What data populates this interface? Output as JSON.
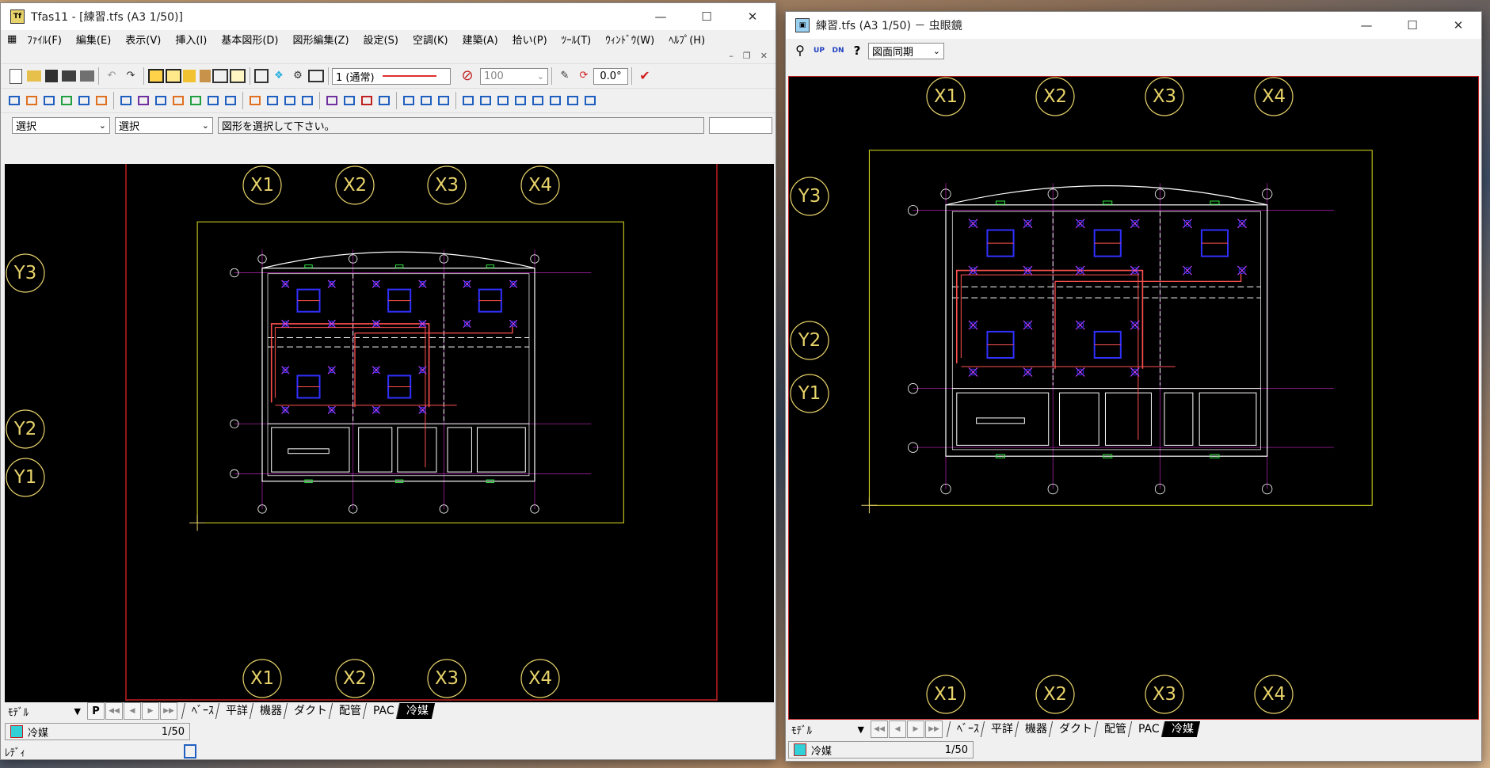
{
  "main": {
    "title": "Tfas11 - [練習.tfs (A3 1/50)]",
    "menu": [
      "ﾌｧｲﾙ(F)",
      "編集(E)",
      "表示(V)",
      "挿入(I)",
      "基本図形(D)",
      "図形編集(Z)",
      "設定(S)",
      "空調(K)",
      "建築(A)",
      "拾い(P)",
      "ﾂｰﾙ(T)",
      "ｳｨﾝﾄﾞｳ(W)",
      "ﾍﾙﾌﾟ(H)"
    ],
    "line_type": "1 (通常)",
    "scale_value": "100",
    "angle": "0.0°",
    "mode_select_1": "選択",
    "mode_select_2": "選択",
    "message": "図形を選択して下さい。",
    "layer_mode": "ﾓﾃﾞﾙ",
    "p_button": "P",
    "tabs": [
      "ﾍﾞｰｽ",
      "平詳",
      "機器",
      "ダクト",
      "配管",
      "PAC",
      "冷媒"
    ],
    "active_tab": "冷媒",
    "layer_name": "冷媒",
    "layer_scale": "1/50",
    "status_text": "ﾚﾃﾞｨ",
    "grid_x": [
      "X1",
      "X2",
      "X3",
      "X4"
    ],
    "grid_y": [
      "Y3",
      "Y2",
      "Y1"
    ]
  },
  "magnifier": {
    "title": "練習.tfs (A3 1/50) － 虫眼鏡",
    "sync_option": "図面同期",
    "layer_mode": "ﾓﾃﾞﾙ",
    "tabs": [
      "ﾍﾞｰｽ",
      "平詳",
      "機器",
      "ダクト",
      "配管",
      "PAC",
      "冷媒"
    ],
    "active_tab": "冷媒",
    "layer_name": "冷媒",
    "layer_scale": "1/50",
    "grid_x": [
      "X1",
      "X2",
      "X3",
      "X4"
    ],
    "grid_y": [
      "Y3",
      "Y2",
      "Y1"
    ]
  },
  "colors": {
    "canvas": "#000000",
    "grid_bubble": "#e8d36a",
    "frame": "#e0e020",
    "pipe": "#ff5050",
    "unit": "#3030ff",
    "wall": "#ffffff",
    "grid_line": "#a020a0"
  }
}
